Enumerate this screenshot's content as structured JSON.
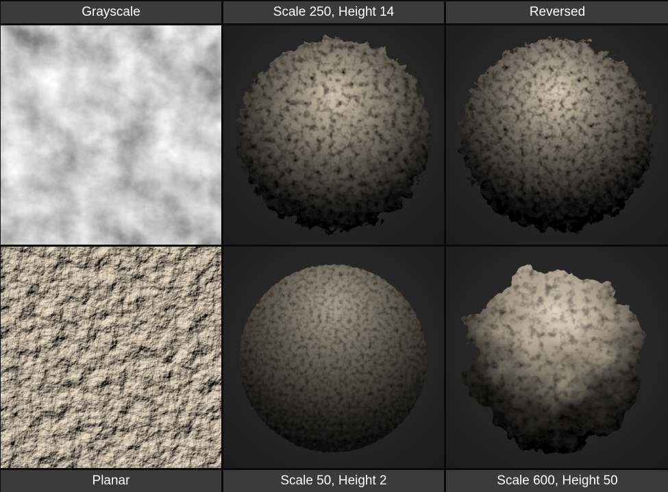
{
  "top_labels": [
    "Grayscale",
    "Scale 250, Height 14",
    "Reversed"
  ],
  "bottom_labels": [
    "Planar",
    "Scale 50, Height 2",
    "Scale 600, Height 50"
  ],
  "colors": {
    "label_bg": "#3b3b3b",
    "label_text": "#ffffff",
    "render_bg": "#2a2a2a",
    "rock_light": "#d8cdb8",
    "rock_dark": "#151515"
  },
  "tiles": [
    {
      "row": 1,
      "col": 1,
      "content": "grayscale noise texture"
    },
    {
      "row": 1,
      "col": 2,
      "content": "displaced sphere render"
    },
    {
      "row": 1,
      "col": 3,
      "content": "displaced sphere render reversed"
    },
    {
      "row": 2,
      "col": 1,
      "content": "planar displacement render"
    },
    {
      "row": 2,
      "col": 2,
      "content": "smooth sphere render"
    },
    {
      "row": 2,
      "col": 3,
      "content": "heavily displaced sphere render"
    }
  ]
}
